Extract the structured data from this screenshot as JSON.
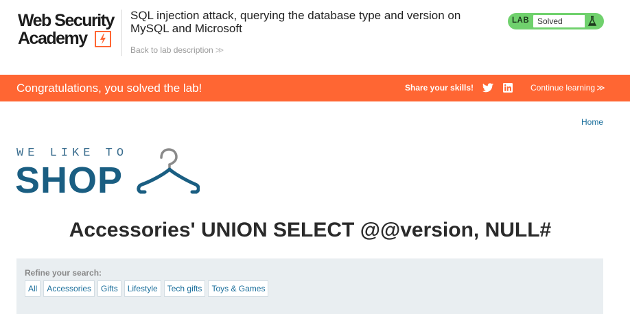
{
  "header": {
    "logo_line1": "Web Security",
    "logo_line2": "Academy",
    "lab_title": "SQL injection attack, querying the database type and version on MySQL and Microsoft",
    "back_link": "Back to lab description",
    "back_chevron": "≫",
    "status_tag": "LAB",
    "status_value": "Solved"
  },
  "banner": {
    "message": "Congratulations, you solved the lab!",
    "share_label": "Share your skills!",
    "continue_label": "Continue learning",
    "continue_chevron": "≫"
  },
  "shop": {
    "home_link": "Home",
    "logo_small": "WE LIKE TO",
    "logo_big": "SHOP",
    "heading": "Accessories' UNION SELECT @@version, NULL#"
  },
  "refine": {
    "label": "Refine your search:",
    "filters": [
      "All",
      "Accessories",
      "Gifts",
      "Lifestyle",
      "Tech gifts",
      "Toys & Games"
    ]
  },
  "colors": {
    "banner": "#ff6633",
    "status_green": "#70d16d",
    "link_blue": "#1a6e9b",
    "shop_blue": "#1a5e82",
    "refine_bg": "#e9eef1"
  },
  "icons": [
    "lightning-bolt-icon",
    "chevron-double-right-icon",
    "flask-icon",
    "twitter-icon",
    "linkedin-icon",
    "clothes-hanger-icon"
  ]
}
